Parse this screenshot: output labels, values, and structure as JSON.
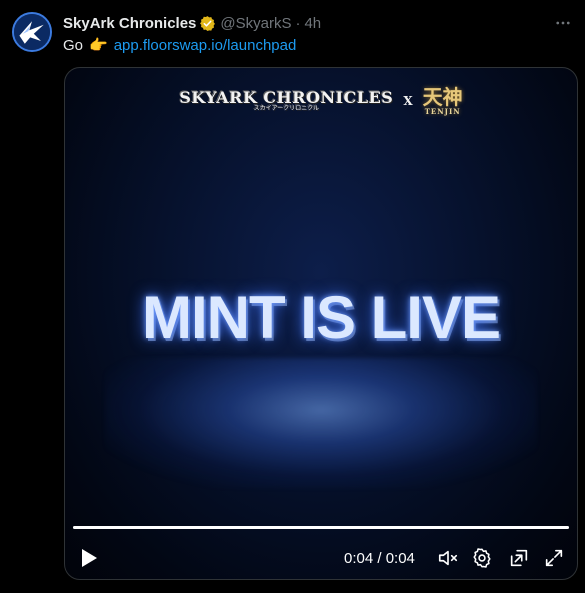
{
  "tweet": {
    "author_name": "SkyArk Chronicles",
    "handle": "@SkyarkS",
    "separator": "·",
    "time": "4h",
    "text_prefix": "Go",
    "emoji": "👉",
    "link": "app.floorswap.io/launchpad",
    "verified_icon": "gold-verified-badge-icon",
    "more_icon": "more-horizontal-icon"
  },
  "media": {
    "logo_left_title": "SKYARK CHRONICLES",
    "logo_left_sub": "スカイアークリロニクル",
    "logo_separator": "X",
    "logo_right_title": "天神",
    "logo_right_sub": "TENJIN",
    "headline": "MINT IS LIVE",
    "video": {
      "progress": 1.0,
      "timecode": "0:04 / 0:04",
      "play_icon": "play-icon",
      "mute_icon": "muted-speaker-icon",
      "settings_icon": "gear-icon",
      "pip_icon": "picture-in-picture-icon",
      "fullscreen_icon": "expand-icon"
    }
  },
  "colors": {
    "background": "#000000",
    "text": "#e7e9ea",
    "muted": "#71767b",
    "link": "#1d9bf0",
    "badge": "#e2b719"
  }
}
